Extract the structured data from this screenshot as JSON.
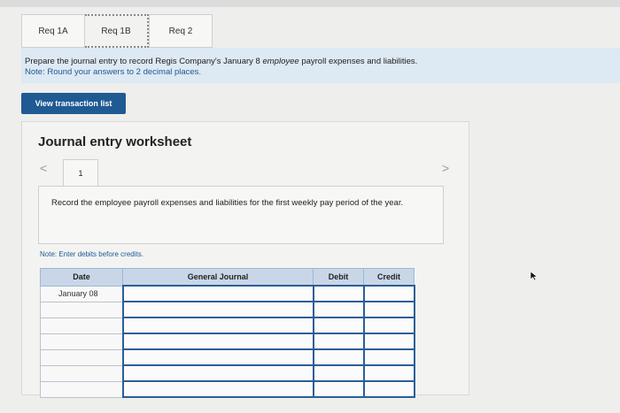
{
  "tabs": [
    {
      "label": "Req 1A",
      "active": false
    },
    {
      "label": "Req 1B",
      "active": true
    },
    {
      "label": "Req 2",
      "active": false
    }
  ],
  "instruction": {
    "before": "Prepare the journal entry to record Regis Company's January 8 ",
    "emphasis": "employee",
    "after": " payroll expenses and liabilities.",
    "note": "Note: Round your answers to 2 decimal places."
  },
  "view_transaction_button": "View transaction list",
  "worksheet": {
    "title": "Journal entry worksheet",
    "nav_prev": "<",
    "nav_next": ">",
    "page_number": "1",
    "record_text": "Record the employee payroll expenses and liabilities for the first weekly pay period of the year.",
    "enter_note": "Note: Enter debits before credits.",
    "table": {
      "headers": [
        "Date",
        "General Journal",
        "Debit",
        "Credit"
      ],
      "rows": [
        {
          "date": "January 08",
          "account": "",
          "debit": "",
          "credit": ""
        },
        {
          "date": "",
          "account": "",
          "debit": "",
          "credit": ""
        },
        {
          "date": "",
          "account": "",
          "debit": "",
          "credit": ""
        },
        {
          "date": "",
          "account": "",
          "debit": "",
          "credit": ""
        },
        {
          "date": "",
          "account": "",
          "debit": "",
          "credit": ""
        },
        {
          "date": "",
          "account": "",
          "debit": "",
          "credit": ""
        },
        {
          "date": "",
          "account": "",
          "debit": "",
          "credit": ""
        }
      ]
    }
  },
  "colors": {
    "accent": "#1f5a93",
    "note": "#1e5a94",
    "instruction_bg": "#dde9f3",
    "table_header": "#c8d6e8"
  }
}
